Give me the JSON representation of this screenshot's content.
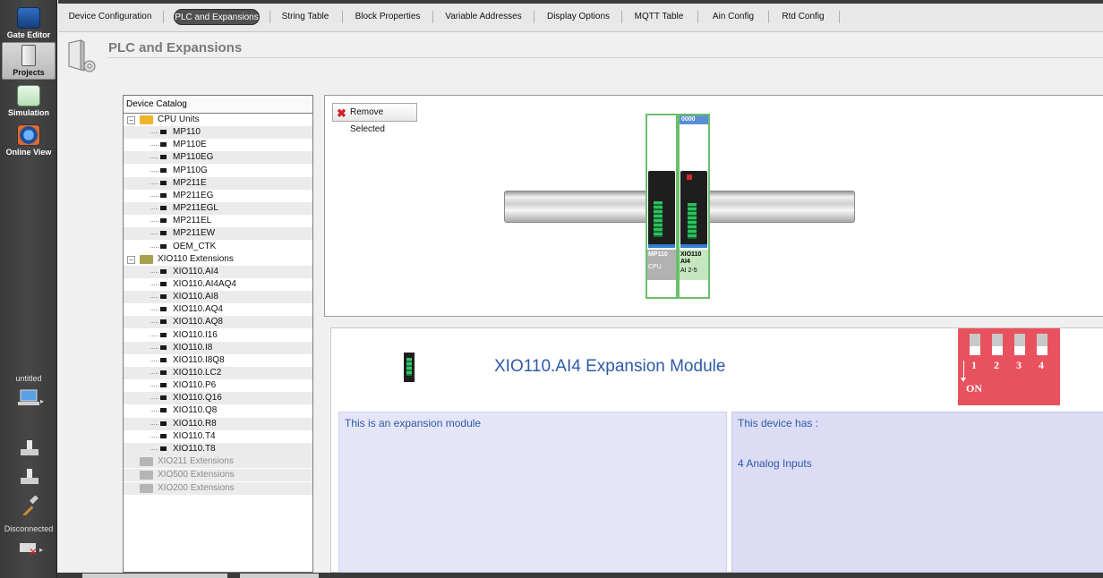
{
  "sidebar": {
    "items": [
      {
        "label": "Gate Editor"
      },
      {
        "label": "Projects"
      },
      {
        "label": "Simulation"
      },
      {
        "label": "Online View"
      }
    ],
    "project_name": "untitled",
    "connection_status": "Disconnected"
  },
  "tabs": [
    {
      "label": "Device Configuration"
    },
    {
      "label": "PLC and Expansions"
    },
    {
      "label": "String Table"
    },
    {
      "label": "Block Properties"
    },
    {
      "label": "Variable Addresses"
    },
    {
      "label": "Display Options"
    },
    {
      "label": "MQTT Table"
    },
    {
      "label": "Ain Config"
    },
    {
      "label": "Rtd Config"
    }
  ],
  "page": {
    "title": "PLC and Expansions"
  },
  "catalog": {
    "header": "Device Catalog",
    "groups": [
      {
        "label": "CPU Units",
        "items": [
          "MP110",
          "MP110E",
          "MP110EG",
          "MP110G",
          "MP211E",
          "MP211EG",
          "MP211EGL",
          "MP211EL",
          "MP211EW",
          "OEM_CTK"
        ]
      },
      {
        "label": "XIO110 Extensions",
        "items": [
          "XIO110.AI4",
          "XIO110.AI4AQ4",
          "XIO110.AI8",
          "XIO110.AQ4",
          "XIO110.AQ8",
          "XIO110.I16",
          "XIO110.I8",
          "XIO110.I8Q8",
          "XIO110.LC2",
          "XIO110.P6",
          "XIO110.Q16",
          "XIO110.Q8",
          "XIO110.R8",
          "XIO110.T4",
          "XIO110.T8"
        ]
      },
      {
        "label": "XIO211 Extensions",
        "items": []
      },
      {
        "label": "XIO500 Extensions",
        "items": []
      },
      {
        "label": "XIO200 Extensions",
        "items": []
      }
    ]
  },
  "canvas": {
    "remove_button": "Remove Selected",
    "modules": [
      {
        "name": "MP110",
        "sub": "CPU",
        "address": ""
      },
      {
        "name": "XIO110 AI4",
        "sub": "AI 2-5",
        "address": "0000"
      }
    ]
  },
  "detail": {
    "title": "XIO110.AI4 Expansion Module",
    "dip_numbers": [
      "1",
      "2",
      "3",
      "4"
    ],
    "dip_on_label": "ON",
    "left_text": "This is an expansion module",
    "right_heading": "This device has :",
    "right_text": "4 Analog Inputs"
  },
  "colors": {
    "module_border": "#6bbf6b",
    "dip_bg": "#e8525e",
    "title_text": "#2e5aa8"
  }
}
